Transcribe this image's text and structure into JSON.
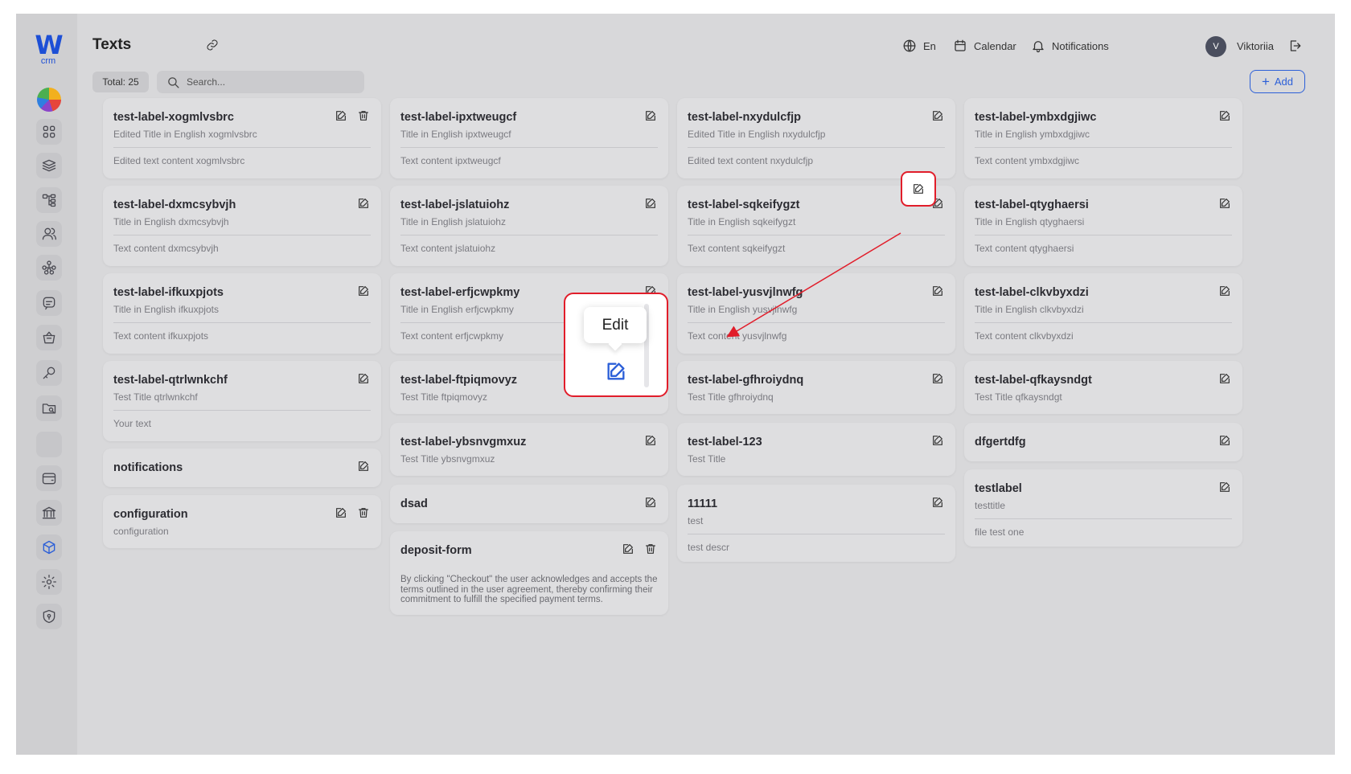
{
  "brand": {
    "logo_letter": "W",
    "logo_sub": "crm"
  },
  "header": {
    "title": "Texts",
    "language": "En",
    "calendar_label": "Calendar",
    "notifications_label": "Notifications",
    "user_initial": "V",
    "user_name": "Viktoriia"
  },
  "toolbar": {
    "total_label": "Total: 25",
    "search_placeholder": "Search...",
    "add_label": "Add",
    "add_symbol": "+"
  },
  "sidebar": {
    "items": [
      {
        "icon": "dashboard-grid-icon"
      },
      {
        "icon": "layers-icon"
      },
      {
        "icon": "hierarchy-icon"
      },
      {
        "icon": "users-icon"
      },
      {
        "icon": "network-icon"
      },
      {
        "icon": "chat-icon"
      },
      {
        "icon": "basket-icon"
      },
      {
        "icon": "key-icon"
      },
      {
        "icon": "folder-search-icon"
      },
      {
        "icon": "blank-slot"
      },
      {
        "icon": "wallet-icon"
      },
      {
        "icon": "bank-icon"
      },
      {
        "icon": "cube-icon",
        "active": true
      },
      {
        "icon": "gear-icon"
      },
      {
        "icon": "shield-icon"
      }
    ]
  },
  "cards": [
    {
      "label": "test-label-xogmlvsbrc",
      "title": "Edited Title in English xogmlvsbrc",
      "text": "Edited text content xogmlvsbrc",
      "delete": true
    },
    {
      "label": "test-label-dxmcsybvjh",
      "title": "Title in English dxmcsybvjh",
      "text": "Text content dxmcsybvjh"
    },
    {
      "label": "test-label-ifkuxpjots",
      "title": "Title in English ifkuxpjots",
      "text": "Text content ifkuxpjots"
    },
    {
      "label": "test-label-qtrlwnkchf",
      "title": "Test Title qtrlwnkchf",
      "text": "Your text"
    },
    {
      "label": "notifications"
    },
    {
      "label": "configuration",
      "title": "configuration",
      "delete": true
    },
    {
      "label": "test-label-ipxtweugcf",
      "title": "Title in English ipxtweugcf",
      "text": "Text content ipxtweugcf"
    },
    {
      "label": "test-label-jslatuiohz",
      "title": "Title in English jslatuiohz",
      "text": "Text content jslatuiohz"
    },
    {
      "label": "test-label-erfjcwpkmy",
      "title": "Title in English erfjcwpkmy",
      "text": "Text content erfjcwpkmy"
    },
    {
      "label": "test-label-ftpiqmovyz",
      "title": "Test Title ftpiqmovyz"
    },
    {
      "label": "test-label-ybsnvgmxuz",
      "title": "Test Title ybsnvgmxuz"
    },
    {
      "label": "dsad"
    },
    {
      "label": "deposit-form",
      "long": "By clicking \"Checkout\" the user acknowledges and accepts the terms outlined in the user agreement, thereby confirming their commitment to fulfill the specified payment terms.",
      "delete": true
    },
    {
      "label": "test-label-nxydulcfjp",
      "title": "Edited Title in English nxydulcfjp",
      "text": "Edited text content nxydulcfjp"
    },
    {
      "label": "test-label-sqkeifygzt",
      "title": "Title in English sqkeifygzt",
      "text": "Text content sqkeifygzt"
    },
    {
      "label": "test-label-yusvjlnwfg",
      "title": "Title in English yusvjlnwfg",
      "text": "Text content yusvjlnwfg"
    },
    {
      "label": "test-label-gfhroiydnq",
      "title": "Test Title gfhroiydnq"
    },
    {
      "label": "test-label-123",
      "title": "Test Title"
    },
    {
      "label": "11111",
      "title": "test",
      "text": "test descr"
    },
    {
      "label": "test-label-ymbxdgjiwc",
      "title": "Title in English ymbxdgjiwc",
      "text": "Text content ymbxdgjiwc"
    },
    {
      "label": "test-label-qtyghaersi",
      "title": "Title in English qtyghaersi",
      "text": "Text content qtyghaersi"
    },
    {
      "label": "test-label-clkvbyxdzi",
      "title": "Title in English clkvbyxdzi",
      "text": "Text content clkvbyxdzi"
    },
    {
      "label": "test-label-qfkaysndgt",
      "title": "Test Title qfkaysndgt"
    },
    {
      "label": "dfgertdfg"
    },
    {
      "label": "testlabel",
      "title": "testtitle",
      "text": "file test one"
    }
  ],
  "callout": {
    "tooltip": "Edit",
    "highlight_color": "#e11d2a"
  },
  "colors": {
    "accent": "#2b5fd8",
    "brand": "#1d4fd6"
  }
}
